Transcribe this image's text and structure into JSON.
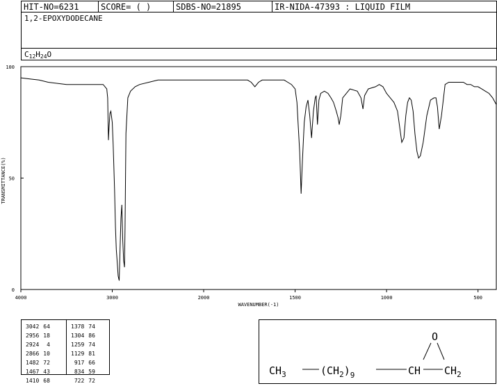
{
  "header": {
    "hit_no": "HIT-NO=6231",
    "score": "SCORE=  (   )",
    "sdbs_no": "SDBS-NO=21895",
    "ir_info": "IR-NIDA-47393 : LIQUID FILM"
  },
  "compound_name": "1,2-EPOXYDODECANE",
  "formula": {
    "c": "C",
    "c_n": "12",
    "h": "H",
    "h_n": "24",
    "o": "O"
  },
  "chart_data": {
    "type": "line",
    "xlabel": "WAVENUMBER(-1)",
    "ylabel": "TRANSMITTANCE(%)",
    "xlim": [
      4000,
      400
    ],
    "ylim": [
      0,
      100
    ],
    "xticks": [
      4000,
      3000,
      2000,
      1500,
      1000,
      500
    ],
    "yticks": [
      0,
      50,
      100
    ],
    "x": [
      4000,
      3900,
      3800,
      3700,
      3600,
      3500,
      3400,
      3300,
      3200,
      3100,
      3060,
      3050,
      3042,
      3035,
      3025,
      3015,
      3000,
      2990,
      2975,
      2965,
      2956,
      2945,
      2935,
      2924,
      2915,
      2905,
      2895,
      2885,
      2875,
      2866,
      2860,
      2850,
      2830,
      2800,
      2750,
      2700,
      2600,
      2500,
      2400,
      2300,
      2200,
      2100,
      2000,
      1900,
      1800,
      1760,
      1740,
      1720,
      1700,
      1680,
      1650,
      1600,
      1560,
      1540,
      1520,
      1500,
      1490,
      1482,
      1475,
      1467,
      1460,
      1450,
      1440,
      1430,
      1420,
      1410,
      1400,
      1390,
      1385,
      1378,
      1370,
      1360,
      1340,
      1320,
      1304,
      1290,
      1275,
      1265,
      1259,
      1250,
      1240,
      1200,
      1160,
      1140,
      1129,
      1120,
      1100,
      1060,
      1040,
      1020,
      1000,
      980,
      960,
      940,
      930,
      917,
      905,
      895,
      885,
      875,
      865,
      855,
      845,
      834,
      825,
      815,
      800,
      780,
      760,
      740,
      730,
      722,
      712,
      700,
      680,
      660,
      640,
      620,
      600,
      580,
      560,
      540,
      520,
      500,
      480,
      460,
      440,
      420,
      400
    ],
    "y": [
      95,
      94.5,
      94,
      93,
      92.5,
      92,
      92,
      92,
      92,
      92,
      90,
      86,
      67,
      73,
      79,
      80,
      75,
      65,
      45,
      28,
      18,
      12,
      6,
      4,
      18,
      32,
      38,
      22,
      13,
      10,
      28,
      70,
      86,
      89,
      91,
      92,
      93,
      94,
      94,
      94,
      94,
      94,
      94,
      94,
      94,
      94,
      93,
      91,
      93,
      94,
      94,
      94,
      94,
      93,
      92,
      90,
      84,
      72,
      62,
      43,
      58,
      75,
      82,
      85,
      78,
      68,
      80,
      86,
      87,
      74,
      85,
      88,
      89,
      88,
      86,
      84,
      80,
      77,
      74,
      78,
      86,
      90,
      89,
      86,
      81,
      87,
      90,
      91,
      92,
      91,
      88,
      86,
      84,
      80,
      74,
      66,
      68,
      78,
      84,
      86,
      85,
      80,
      70,
      62,
      59,
      60,
      66,
      78,
      85,
      86,
      86,
      82,
      72,
      78,
      92,
      93,
      93,
      93,
      93,
      93,
      92,
      92,
      91,
      91,
      90,
      89,
      88,
      86,
      83,
      80
    ]
  },
  "peaks": [
    [
      "3042",
      "64"
    ],
    [
      "2956",
      "18"
    ],
    [
      "2924",
      "4"
    ],
    [
      "2866",
      "10"
    ],
    [
      "1482",
      "72"
    ],
    [
      "1467",
      "43"
    ],
    [
      "1410",
      "68"
    ],
    [
      "1378",
      "74"
    ],
    [
      "1304",
      "86"
    ],
    [
      "1259",
      "74"
    ],
    [
      "1129",
      "81"
    ],
    [
      "917",
      "66"
    ],
    [
      "834",
      "59"
    ],
    [
      "722",
      "72"
    ]
  ],
  "structure": {
    "o_label": "O",
    "ch3": "CH",
    "ch3_sub": "3",
    "chain": "(CH",
    "chain_sub": "2",
    "chain_close": ")",
    "chain_n": "9",
    "ch": "CH",
    "ch2": "CH",
    "ch2_sub": "2"
  }
}
